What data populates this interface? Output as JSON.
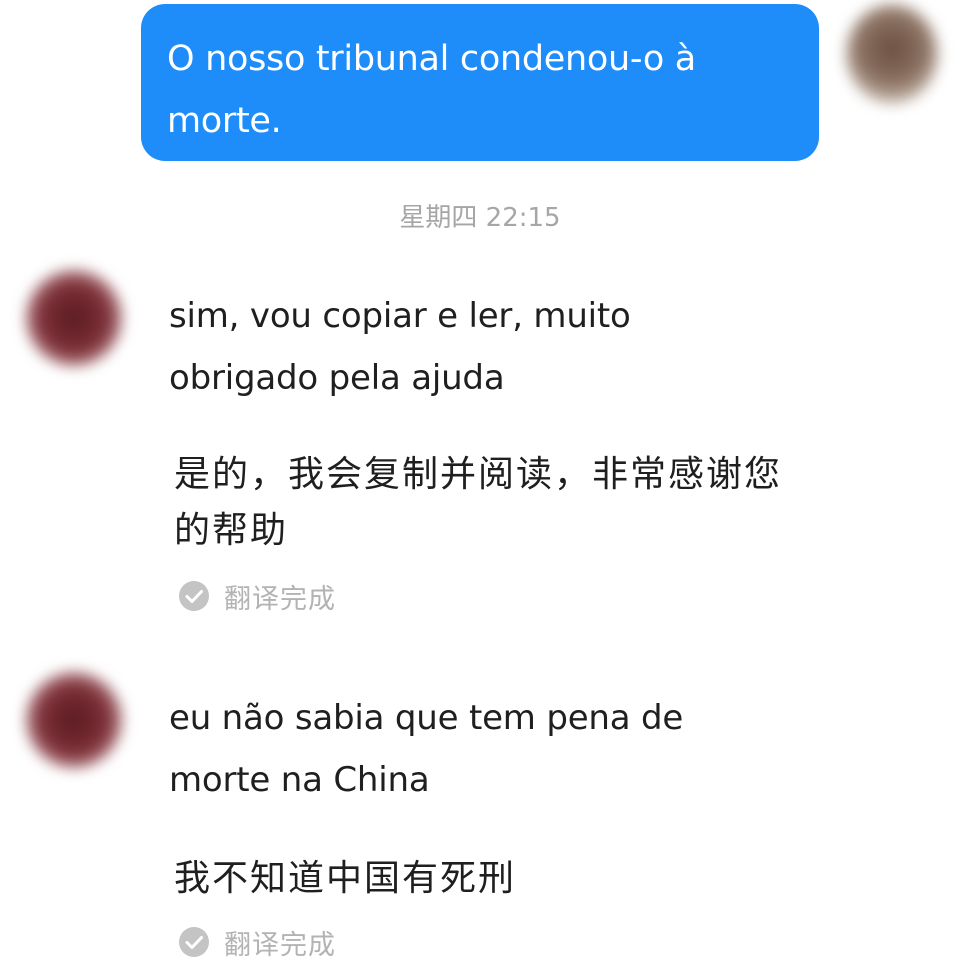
{
  "outgoing": {
    "text": "O nosso tribunal condenou-o  à morte."
  },
  "timestamp": "星期四 22:15",
  "messages": [
    {
      "text": "sim, vou copiar e ler, muito obrigado pela ajuda",
      "translation": "是的，我会复制并阅读，非常感谢您的帮助",
      "status": "翻译完成"
    },
    {
      "text": "eu não sabia que tem pena de morte na China",
      "translation": "我不知道中国有死刑",
      "status": "翻译完成"
    }
  ],
  "colors": {
    "outgoing_bubble": "#1e8dfa",
    "timestamp_text": "#a6a6a6",
    "status_text": "#b3b3b3"
  },
  "icons": {
    "status_icon": "check-circle-icon"
  }
}
